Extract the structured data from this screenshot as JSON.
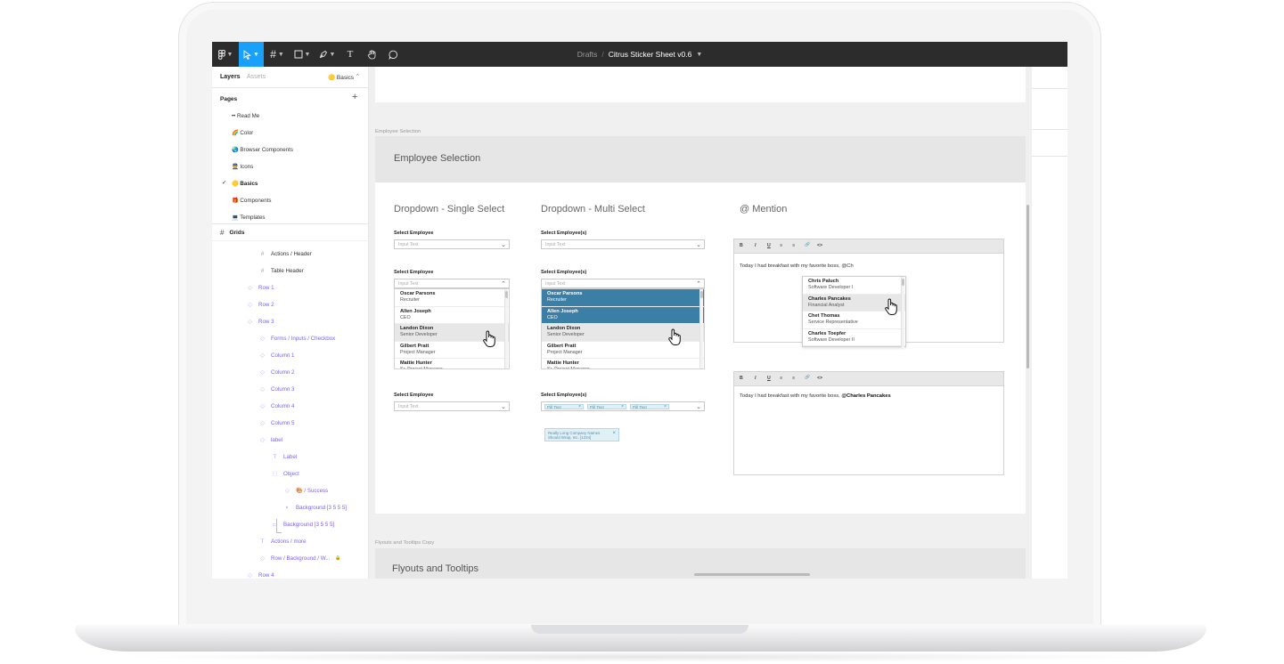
{
  "toolbar": {
    "crumb": "Drafts",
    "separator": "/",
    "file_name": "Citrus Sticker Sheet v0.6"
  },
  "left_panel": {
    "tabs": {
      "layers": "Layers",
      "assets": "Assets",
      "page_badge": "🟡 Basics"
    },
    "pages_heading": "Pages",
    "add_page": "+",
    "pages": [
      {
        "label": "•• Read Me",
        "selected": false
      },
      {
        "label": "🌈 Color",
        "selected": false
      },
      {
        "label": "🌏 Browser Components",
        "selected": false
      },
      {
        "label": "👮 Icons",
        "selected": false
      },
      {
        "label": "🟡 Basics",
        "selected": true
      },
      {
        "label": "🎁 Components",
        "selected": false
      },
      {
        "label": "💻 Templates",
        "selected": false
      }
    ],
    "checkmark": "✓",
    "grids_label": "Grids",
    "layers": [
      {
        "label": "Actions / Header",
        "icon": "#",
        "style": "dark"
      },
      {
        "label": "Table Header",
        "icon": "#",
        "style": "dark"
      },
      {
        "label": "Row 1",
        "icon": "◇",
        "style": "purple"
      },
      {
        "label": "Row 2",
        "icon": "◇",
        "style": "purple"
      },
      {
        "label": "Row 3",
        "icon": "◇",
        "style": "purple"
      },
      {
        "label": "Forms / Inputs / Checkbox",
        "icon": "◇",
        "style": "purple"
      },
      {
        "label": "Column 1",
        "icon": "◇",
        "style": "purple"
      },
      {
        "label": "Column 2",
        "icon": "◇",
        "style": "purple"
      },
      {
        "label": "Column 3",
        "icon": "◇",
        "style": "purple"
      },
      {
        "label": "Column 4",
        "icon": "◇",
        "style": "purple"
      },
      {
        "label": "Column 5",
        "icon": "◇",
        "style": "purple"
      },
      {
        "label": "label",
        "icon": "◇",
        "style": "purple"
      },
      {
        "label": "Label",
        "icon": "T",
        "style": "purple"
      },
      {
        "label": "Object",
        "icon": "⬚",
        "style": "purple"
      },
      {
        "label": "🎨 / Success",
        "icon": "◇",
        "style": "purple"
      },
      {
        "label": "Background [3 5 5 5]",
        "icon": "◐",
        "style": "purple"
      },
      {
        "label": "Background [3 5 5 5]",
        "icon": "▭",
        "style": "purple"
      },
      {
        "label": "Actions / more",
        "icon": "T",
        "style": "purple"
      },
      {
        "label": "Row / Background / W...",
        "icon": "◇",
        "style": "purple",
        "locked": true
      },
      {
        "label": "Row 4",
        "icon": "◇",
        "style": "purple"
      }
    ],
    "lock_icon": "🔒"
  },
  "canvas": {
    "frame_label_1": "Employee Selection",
    "section_header": "Employee Selection",
    "col_single": "Dropdown - Single Select",
    "col_multi": "Dropdown - Multi Select",
    "col_mention": "@ Mention",
    "single": {
      "label": "Select Employee",
      "placeholder": "Input Text"
    },
    "multi": {
      "label": "Select Employee(s)",
      "placeholder": "Input Text"
    },
    "employees": [
      {
        "name": "Oscar Parsons",
        "role": "Recruiter"
      },
      {
        "name": "Allen Joseph",
        "role": "CEO"
      },
      {
        "name": "Landon Dixon",
        "role": "Senior Developer"
      },
      {
        "name": "Gilbert Pratt",
        "role": "Project Manager"
      },
      {
        "name": "Mattie Hunter",
        "role": "Sr. Project Manager"
      }
    ],
    "pills": [
      "Pill Text",
      "Pill Text",
      "Pill Text"
    ],
    "pill_close": "×",
    "long_pill": "Really Long Company Names Should Wrap, Inc. [1234]",
    "editor_buttons": [
      "B",
      "I",
      "U",
      "≡",
      "≡",
      "🔗",
      "<>"
    ],
    "mention_text_typing": "Today I had breakfast with my favorite boss, @Ch",
    "mention_text_done_prefix": "Today I had breakfast with my favorite boss, ",
    "mention_text_done_name": "@Charles Pancakes",
    "mention_people": [
      {
        "name": "Chris Paluch",
        "role": "Software Developer I"
      },
      {
        "name": "Charles Pancakes",
        "role": "Financial Analyst"
      },
      {
        "name": "Chet Thomas",
        "role": "Service Representative"
      },
      {
        "name": "Charles Toepfer",
        "role": "Software Developer II"
      }
    ],
    "frame_label_2": "Flyouts and Tooltips Copy",
    "section2_header": "Flyouts and Tooltips"
  }
}
